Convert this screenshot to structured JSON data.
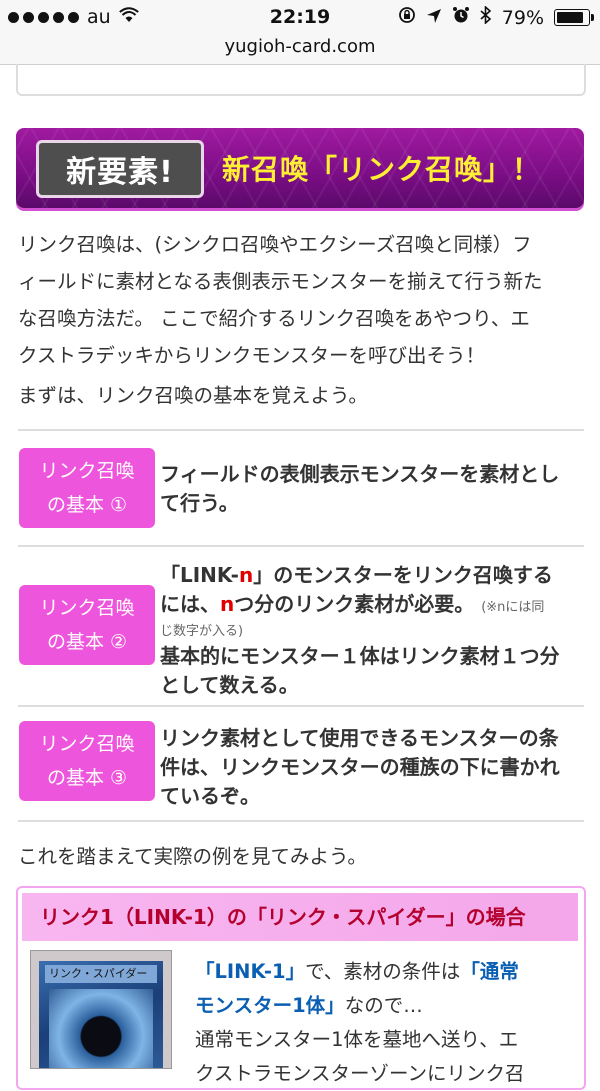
{
  "status": {
    "carrier": "au",
    "time": "22:19",
    "battery": "79%",
    "url": "yugioh-card.com"
  },
  "banner": {
    "badge": "新要素!",
    "title": "新召喚「リンク召喚」！"
  },
  "intro": {
    "p1": [
      "リンク召喚は、(シンクロ召喚やエクシーズ召喚と同様）フ",
      "ィールドに素材となる表側表示モンスターを揃えて行う新た",
      "な召喚方法だ。 ここで紹介するリンク召喚をあやつり、エ",
      "クストラデッキからリンクモンスターを呼び出そう！"
    ],
    "p2": "まずは、リンク召喚の基本を覚えよう。",
    "p3": "これを踏まえて実際の例を見てみよう。"
  },
  "basics": [
    {
      "tag_line1": "リンク召喚",
      "tag_line2": "の基本 ①",
      "text_line1": "フィールドの表側表示モンスターを素材とし",
      "text_line2": "て行う。"
    },
    {
      "tag_line1": "リンク召喚",
      "tag_line2": "の基本 ②",
      "t1a": "「LINK-",
      "t1n": "n",
      "t1b": "」のモンスターをリンク召喚する",
      "t2a": "には、",
      "t2n": "n",
      "t2b": "つ分のリンク素材が必要。",
      "note1": "(※nには同",
      "note2": "じ数字が入る)",
      "t3": "基本的にモンスター１体はリンク素材１つ分",
      "t4": "として数える。"
    },
    {
      "tag_line1": "リンク召喚",
      "tag_line2": "の基本 ③",
      "text_line1": "リンク素材として使用できるモンスターの条",
      "text_line2": "件は、リンクモンスターの種族の下に書かれ",
      "text_line3": "ているぞ。"
    }
  ],
  "example": {
    "head_a": "リンク1（LINK-1）",
    "head_b": "の「リンク・スパイダー」の場合",
    "card_name": "リンク・スパイダー",
    "l1a": "「LINK-1」",
    "l1b": "で、素材の条件は",
    "l1c": "「通常",
    "l2a": "モンスター1体」",
    "l2b": "なので…",
    "l3": "通常モンスター1体を墓地へ送り、エ",
    "l4": "クストラモンスターゾーンにリンク召"
  },
  "colors": {
    "banner_purple": "#7a0d85",
    "tag_pink": "#ee55dd",
    "title_yellow": "#ffef33",
    "accent_red": "#e00000",
    "link_blue": "#0b5fb3"
  }
}
